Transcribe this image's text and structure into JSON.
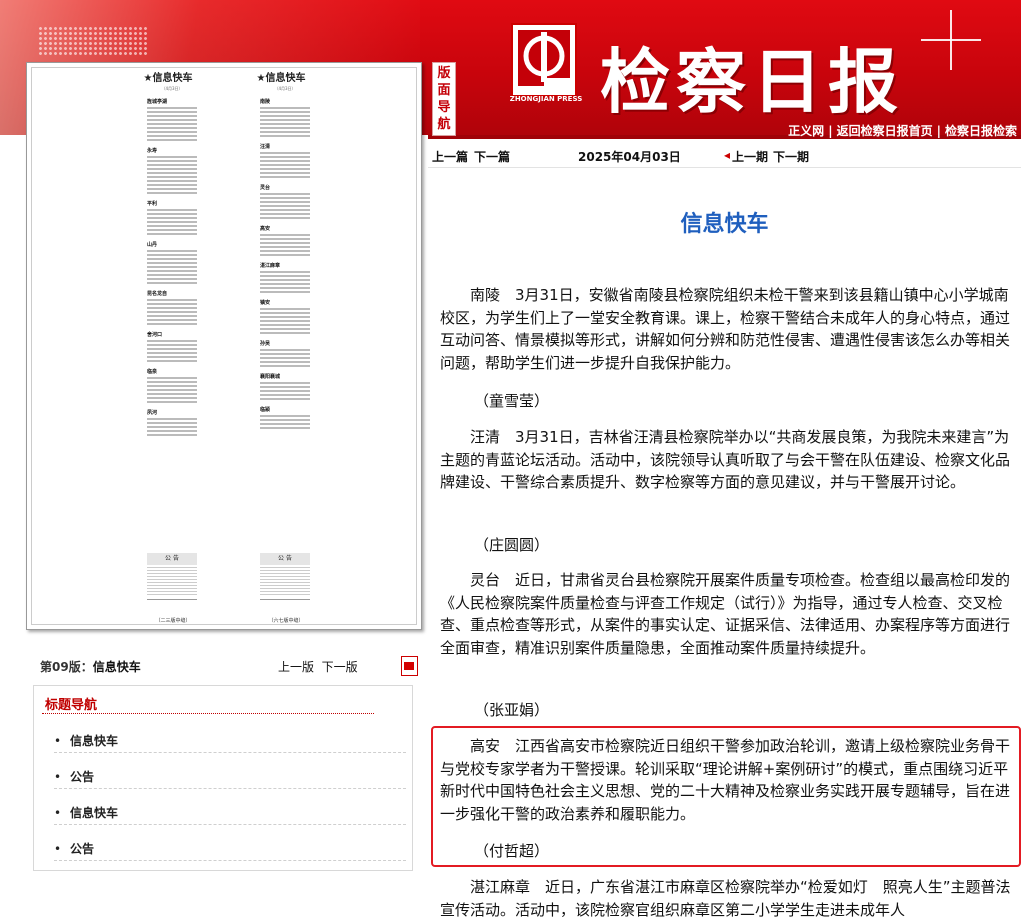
{
  "header": {
    "masthead": "检察日报",
    "logo_text": "ZHONGJIAN PRESS",
    "logo_badge": "中检报业",
    "nav_tag": [
      "版",
      "面",
      "导",
      "航"
    ],
    "links": [
      "正义网",
      "|",
      "返回检察日报首页",
      "|",
      "检察日报检索"
    ]
  },
  "toolbar": {
    "prev_article": "上一篇",
    "next_article": "下一篇",
    "date": "2025年04月03日",
    "prev_issue": "上一期",
    "next_issue": "下一期"
  },
  "page_image": {
    "left_col": {
      "title": "★信息快车",
      "date": "（4月3日）",
      "heads": [
        "旌城亭湖",
        "永寿",
        "平利",
        "山丹",
        "昆名龙自",
        "舍河口",
        "临泉",
        "夙河"
      ],
      "notice": "公  告",
      "caption": "（二三版中缝）"
    },
    "right_col": {
      "title": "★信息快车",
      "date": "（4月3日）",
      "heads": [
        "南陵",
        "汪清",
        "灵台",
        "高安",
        "湛江麻章",
        "镇安",
        "孙吴",
        "襄阳襄城",
        "临颍"
      ],
      "notice": "公  告",
      "caption": "（六七版中缝）"
    }
  },
  "version_bar": {
    "label_prefix": "第09版：",
    "label_name": "信息快车",
    "prev_page": "上一版",
    "next_page": "下一版"
  },
  "title_nav": {
    "heading": "标题导航",
    "items": [
      "信息快车",
      "公告",
      "信息快车",
      "公告"
    ]
  },
  "article": {
    "title": "信息快车",
    "paragraphs": [
      {
        "text": "南陵　3月31日，安徽省南陵县检察院组织未检干警来到该县籍山镇中心小学城南校区，为学生们上了一堂安全教育课。课上，检察干警结合未成年人的身心特点，通过互动问答、情景模拟等形式，讲解如何分辨和防范性侵害、遭遇性侵害该怎么办等相关问题，帮助学生们进一步提升自我保护能力。",
        "author": "（童雪莹）"
      },
      {
        "text": "汪清　3月31日，吉林省汪清县检察院举办以“共商发展良策，为我院未来建言”为主题的青蓝论坛活动。活动中，该院领导认真听取了与会干警在队伍建设、检察文化品牌建设、干警综合素质提升、数字检察等方面的意见建议，并与干警展开讨论。",
        "author": "（庄圆圆）"
      },
      {
        "text": "灵台　近日，甘肃省灵台县检察院开展案件质量专项检查。检查组以最高检印发的《人民检察院案件质量检查与评查工作规定（试行）》为指导，通过专人检查、交叉检查、重点检查等形式，从案件的事实认定、证据采信、法律适用、办案程序等方面进行全面审查，精准识别案件质量隐患，全面推动案件质量持续提升。",
        "author": "（张亚娟）"
      },
      {
        "text": "高安　江西省高安市检察院近日组织干警参加政治轮训，邀请上级检察院业务骨干与党校专家学者为干警授课。轮训采取“理论讲解+案例研讨”的模式，重点围绕习近平新时代中国特色社会主义思想、党的二十大精神及检察业务实践开展专题辅导，旨在进一步强化干警的政治素养和履职能力。",
        "author": "（付哲超）"
      },
      {
        "text": "湛江麻章　近日，广东省湛江市麻章区检察院举办“检爱如灯　照亮人生”主题普法宣传活动。活动中，该院检察官组织麻章区第二小学学生走进未成年人",
        "author": ""
      }
    ]
  }
}
